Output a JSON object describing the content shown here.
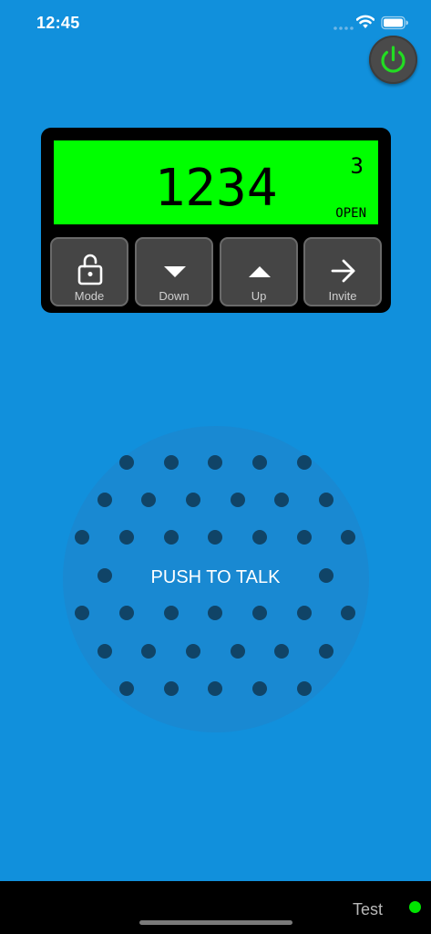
{
  "status_bar": {
    "time": "12:45"
  },
  "power": {
    "icon": "power-icon",
    "color": "#22dd22"
  },
  "display": {
    "code": "1234",
    "channel": "3",
    "status": "OPEN",
    "background": "#00ff00"
  },
  "controls": {
    "mode": {
      "label": "Mode",
      "icon": "unlocked-padlock-icon"
    },
    "down": {
      "label": "Down",
      "icon": "triangle-down-icon"
    },
    "up": {
      "label": "Up",
      "icon": "triangle-up-icon"
    },
    "invite": {
      "label": "Invite",
      "icon": "arrow-right-icon"
    }
  },
  "ptt": {
    "label": "PUSH TO TALK"
  },
  "footer": {
    "label": "Test",
    "indicator_color": "#00e400"
  },
  "colors": {
    "background": "#1190dc",
    "panel": "#000000",
    "button": "#454545",
    "speaker_dots": "#104467"
  }
}
